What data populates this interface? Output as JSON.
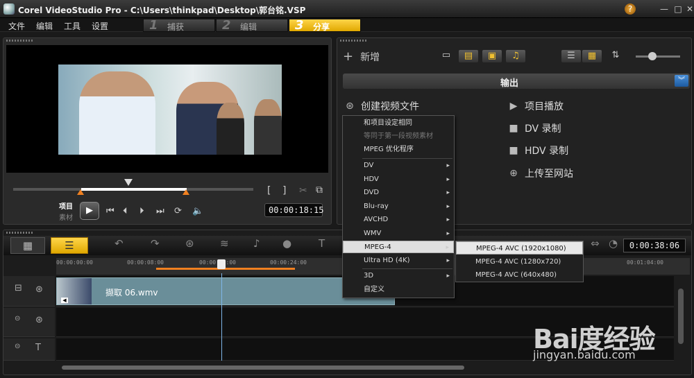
{
  "window": {
    "title": "Corel VideoStudio Pro - C:\\Users\\thinkpad\\Desktop\\郭台铭.VSP"
  },
  "menu": [
    "文件",
    "编辑",
    "工具",
    "设置"
  ],
  "steps": [
    {
      "num": "1",
      "label": "捕获"
    },
    {
      "num": "2",
      "label": "编辑"
    },
    {
      "num": "3",
      "label": "分享"
    }
  ],
  "player": {
    "mode_project": "项目",
    "mode_clip": "素材",
    "timecode": "00:00:18:15",
    "mark_in": "[",
    "mark_out": "]"
  },
  "library": {
    "add_label": "新增"
  },
  "output": {
    "title": "输出",
    "create_video": "创建视频文件",
    "project_playback": "项目播放",
    "dv_record": "DV 录制",
    "hdv_record": "HDV 录制",
    "upload_web": "上传至网站"
  },
  "context_menu": {
    "items": [
      {
        "label": "和项目设定相同"
      },
      {
        "label": "等同于第一段视频素材"
      },
      {
        "label": "MPEG 优化程序"
      },
      {
        "label": "DV"
      },
      {
        "label": "HDV"
      },
      {
        "label": "DVD"
      },
      {
        "label": "Blu-ray"
      },
      {
        "label": "AVCHD"
      },
      {
        "label": "WMV"
      },
      {
        "label": "MPEG-4"
      },
      {
        "label": "Ultra HD (4K)"
      },
      {
        "label": "3D"
      },
      {
        "label": "自定义"
      }
    ]
  },
  "sub_menu": {
    "items": [
      {
        "label": "MPEG-4 AVC (1920x1080)"
      },
      {
        "label": "MPEG-4 AVC (1280x720)"
      },
      {
        "label": "MPEG-4 AVC (640x480)"
      }
    ]
  },
  "timeline": {
    "duration": "0:00:38:06",
    "ticks": [
      "00:00:00:00",
      "00:00:08:00",
      "00:00:16:00",
      "00:00:24:00",
      "00:01:04:00"
    ],
    "clip_label": "撷取 06.wmv"
  },
  "watermark": {
    "logo": "Bai度经验",
    "url": "jingyan.baidu.com"
  }
}
